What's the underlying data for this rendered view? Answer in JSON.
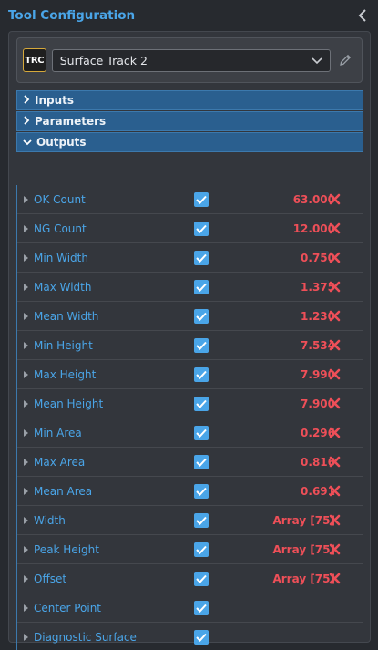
{
  "header": {
    "title": "Tool Configuration"
  },
  "tool": {
    "badge": "TRC",
    "selected": "Surface Track 2"
  },
  "sections": {
    "inputs": "Inputs",
    "parameters": "Parameters",
    "outputs": "Outputs"
  },
  "outputs": [
    {
      "name": "OK Count",
      "checked": true,
      "value": "63.000"
    },
    {
      "name": "NG Count",
      "checked": true,
      "value": "12.000"
    },
    {
      "name": "Min Width",
      "checked": true,
      "value": "0.750"
    },
    {
      "name": "Max Width",
      "checked": true,
      "value": "1.375"
    },
    {
      "name": "Mean Width",
      "checked": true,
      "value": "1.230"
    },
    {
      "name": "Min Height",
      "checked": true,
      "value": "7.534"
    },
    {
      "name": "Max Height",
      "checked": true,
      "value": "7.990"
    },
    {
      "name": "Mean Height",
      "checked": true,
      "value": "7.900"
    },
    {
      "name": "Min Area",
      "checked": true,
      "value": "0.296"
    },
    {
      "name": "Max Area",
      "checked": true,
      "value": "0.816"
    },
    {
      "name": "Mean Area",
      "checked": true,
      "value": "0.691"
    },
    {
      "name": "Width",
      "checked": true,
      "value": "Array [75]"
    },
    {
      "name": "Peak Height",
      "checked": true,
      "value": "Array [75]"
    },
    {
      "name": "Offset",
      "checked": true,
      "value": "Array [75]"
    },
    {
      "name": "Center Point",
      "checked": true,
      "value": ""
    },
    {
      "name": "Diagnostic Surface",
      "checked": true,
      "value": ""
    }
  ],
  "colors": {
    "accent": "#4aa5e8",
    "section_header": "#2a5f8f",
    "value_fail": "#ee4f58",
    "badge_border": "#d6a93b"
  }
}
